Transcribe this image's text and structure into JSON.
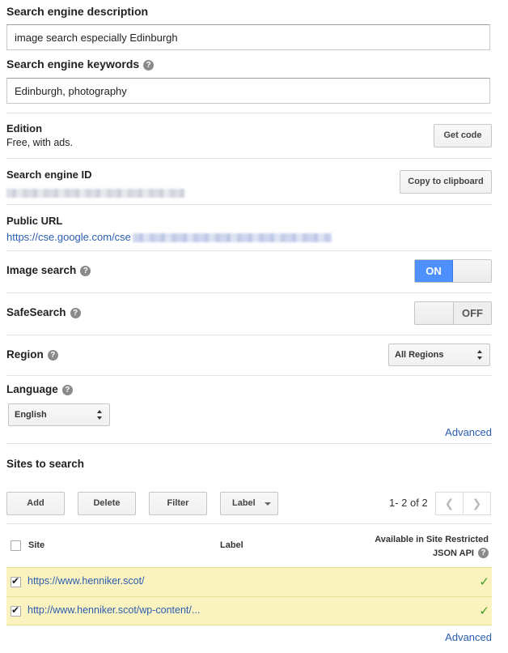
{
  "description": {
    "label": "Search engine description",
    "value": "image search especially Edinburgh"
  },
  "keywords": {
    "label": "Search engine keywords",
    "value": "Edinburgh, photography",
    "help": "?"
  },
  "edition": {
    "label": "Edition",
    "value": "Free, with ads.",
    "button": "Get code"
  },
  "engine_id": {
    "label": "Search engine ID",
    "button": "Copy to clipboard"
  },
  "public_url": {
    "label": "Public URL",
    "prefix": "https://cse.google.com/cse"
  },
  "image_search": {
    "label": "Image search",
    "help": "?",
    "state_label": "ON",
    "enabled": true
  },
  "safesearch": {
    "label": "SafeSearch",
    "help": "?",
    "state_label": "OFF",
    "enabled": false
  },
  "region": {
    "label": "Region",
    "help": "?",
    "selected": "All Regions"
  },
  "language": {
    "label": "Language",
    "help": "?",
    "selected": "English",
    "advanced_link": "Advanced"
  },
  "sites": {
    "title": "Sites to search",
    "toolbar": {
      "add": "Add",
      "delete": "Delete",
      "filter": "Filter",
      "label": "Label"
    },
    "pagination": "1- 2 of 2",
    "columns": {
      "site": "Site",
      "label": "Label",
      "api_line1": "Available in Site Restricted",
      "api_line2": "JSON API"
    },
    "rows": [
      {
        "url": "https://www.henniker.scot/",
        "checked": true,
        "available": "✓"
      },
      {
        "url": "http://www.henniker.scot/wp-content/...",
        "checked": true,
        "available": "✓"
      }
    ],
    "advanced_link": "Advanced"
  },
  "colors": {
    "accent": "#4d90fe",
    "link": "#2a5db0",
    "row_highlight": "#fbf3bf",
    "check_green": "#3a9d23"
  }
}
